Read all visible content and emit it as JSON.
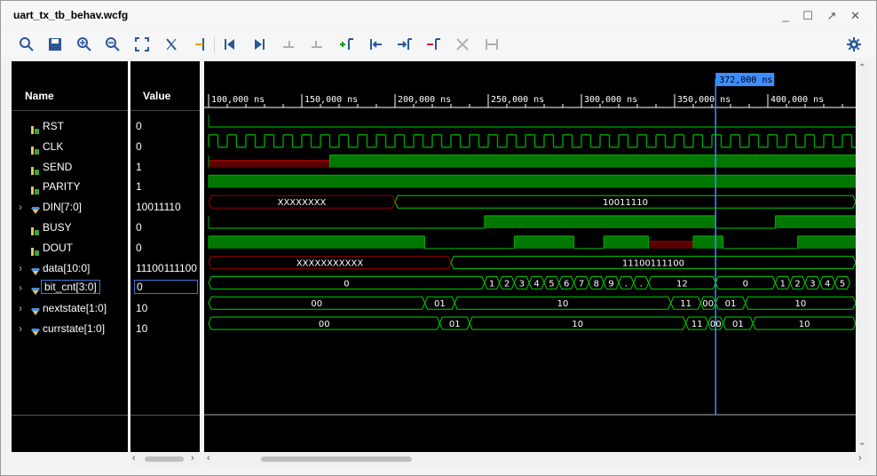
{
  "window": {
    "title": "uart_tx_tb_behav.wcfg",
    "controls": [
      "_",
      "☐",
      "↗",
      "✕"
    ]
  },
  "toolbar": {
    "buttons": [
      "zoom-fit-icon",
      "save-icon",
      "zoom-in-icon",
      "zoom-out-icon",
      "fullscreen-icon",
      "cursor-icon",
      "add-marker-icon",
      "go-start-icon",
      "go-end-icon",
      "prev-transition-icon",
      "next-transition-icon",
      "add-marker-icon-2",
      "prev-marker-icon",
      "next-marker-icon",
      "swap-cursors-icon",
      "delete-marker-icon",
      "snap-icon",
      "settings-icon"
    ]
  },
  "columns": {
    "name": "Name",
    "value": "Value"
  },
  "cursor": {
    "label": "372,000 ns"
  },
  "timeline": {
    "ticks": [
      "100,000 ns",
      "150,000 ns",
      "200,000 ns",
      "250,000 ns",
      "300,000 ns",
      "350,000 ns",
      "400,000 ns"
    ]
  },
  "signals": [
    {
      "name": "RST",
      "value": "0",
      "expandable": false,
      "bus": false
    },
    {
      "name": "CLK",
      "value": "0",
      "expandable": false,
      "bus": false
    },
    {
      "name": "SEND",
      "value": "1",
      "expandable": false,
      "bus": false
    },
    {
      "name": "PARITY",
      "value": "1",
      "expandable": false,
      "bus": false
    },
    {
      "name": "DIN[7:0]",
      "value": "10011110",
      "expandable": true,
      "bus": true
    },
    {
      "name": "BUSY",
      "value": "0",
      "expandable": false,
      "bus": false
    },
    {
      "name": "DOUT",
      "value": "0",
      "expandable": false,
      "bus": false
    },
    {
      "name": "data[10:0]",
      "value": "11100111100",
      "expandable": true,
      "bus": true
    },
    {
      "name": "bit_cnt[3:0]",
      "value": "0",
      "expandable": true,
      "bus": true,
      "selected": true
    },
    {
      "name": "nextstate[1:0]",
      "value": "10",
      "expandable": true,
      "bus": true
    },
    {
      "name": "currstate[1:0]",
      "value": "10",
      "expandable": true,
      "bus": true
    }
  ],
  "waves": {
    "din": [
      "XXXXXXXX",
      "10011110"
    ],
    "data": [
      "XXXXXXXXXXX",
      "11100111100"
    ],
    "bit_cnt": [
      "0",
      "1",
      "2",
      "3",
      "4",
      "5",
      "6",
      "7",
      "8",
      "9",
      ".",
      ".",
      "12",
      "0",
      "1",
      "2",
      "3",
      "4",
      "5"
    ],
    "nextstate": [
      "00",
      "01",
      "10",
      "11",
      "00",
      "01",
      "10"
    ],
    "currstate": [
      "00",
      "01",
      "10",
      "11",
      "00",
      "01",
      "10"
    ]
  },
  "colors": {
    "high": "#00a400",
    "fill": "#007800",
    "undefined": "#9b0000",
    "undefinedFill": "#5a0000",
    "cursor": "#3c8dff",
    "bus": "#00d000"
  }
}
